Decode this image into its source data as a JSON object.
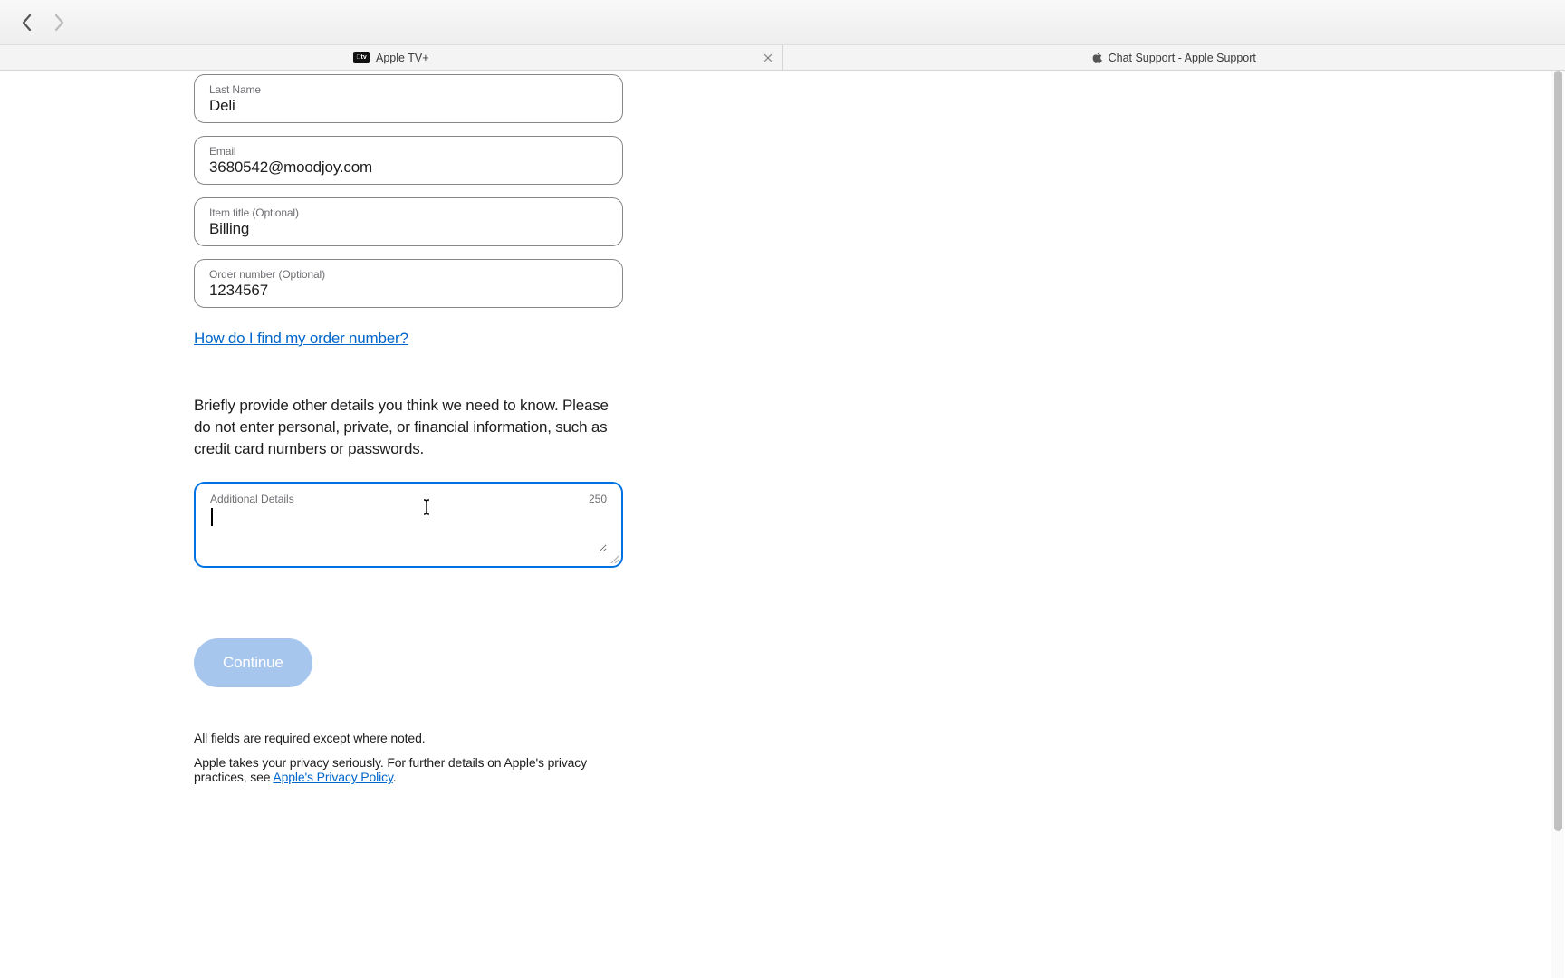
{
  "tabs": [
    {
      "title": "Apple TV+",
      "icon": "atv"
    },
    {
      "title": "Chat Support - Apple Support",
      "icon": "apple"
    }
  ],
  "form": {
    "last_name": {
      "label": "Last Name",
      "value": "Deli"
    },
    "email": {
      "label": "Email",
      "value": "3680542@moodjoy.com"
    },
    "item_title": {
      "label": "Item title (Optional)",
      "value": "Billing"
    },
    "order_number": {
      "label": "Order number (Optional)",
      "value": "1234567"
    },
    "order_help_link": "How do I find my order number?",
    "instructions": "Briefly provide other details you think we need to know. Please do not enter personal, private, or financial information, such as credit card numbers or passwords.",
    "additional_details": {
      "label": "Additional Details",
      "char_count": "250",
      "value": ""
    },
    "continue_label": "Continue",
    "required_note": "All fields are required except where noted.",
    "privacy_prefix": "Apple takes your privacy seriously. For further details on Apple's privacy practices, see ",
    "privacy_link": "Apple's Privacy Policy",
    "privacy_suffix": "."
  }
}
